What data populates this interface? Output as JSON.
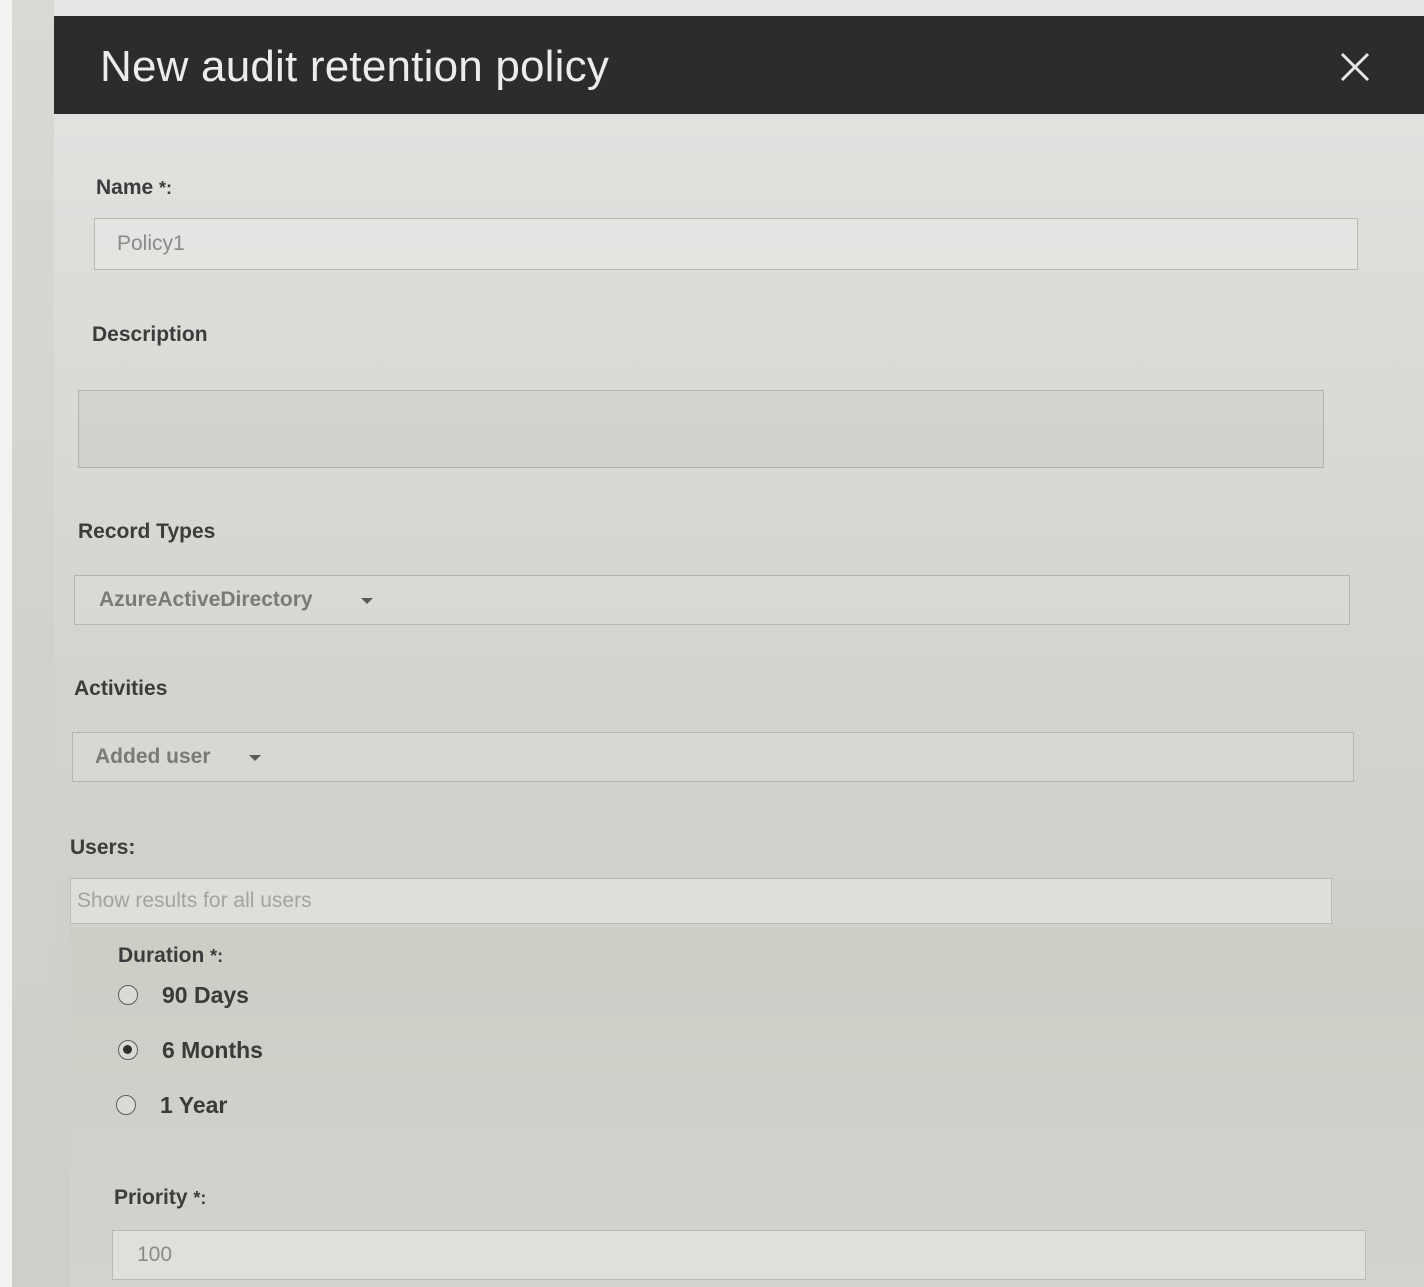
{
  "dialog": {
    "title": "New audit retention policy",
    "close_icon": "close-icon"
  },
  "form": {
    "name": {
      "label": "Name",
      "required_mark": "*:",
      "value": "Policy1"
    },
    "description": {
      "label": "Description",
      "value": ""
    },
    "record_types": {
      "label": "Record Types",
      "selected": "AzureActiveDirectory"
    },
    "activities": {
      "label": "Activities",
      "selected": "Added user"
    },
    "users": {
      "label": "Users:",
      "placeholder": "Show results for all users"
    },
    "duration": {
      "label": "Duration",
      "required_mark": "*:",
      "options": [
        {
          "label": "90 Days",
          "checked": false
        },
        {
          "label": "6 Months",
          "checked": true
        },
        {
          "label": "1 Year",
          "checked": false
        }
      ]
    },
    "priority": {
      "label": "Priority",
      "required_mark": "*:",
      "value": "100"
    }
  },
  "colors": {
    "header_bg": "#2c2c2c",
    "header_text": "#ececec"
  }
}
